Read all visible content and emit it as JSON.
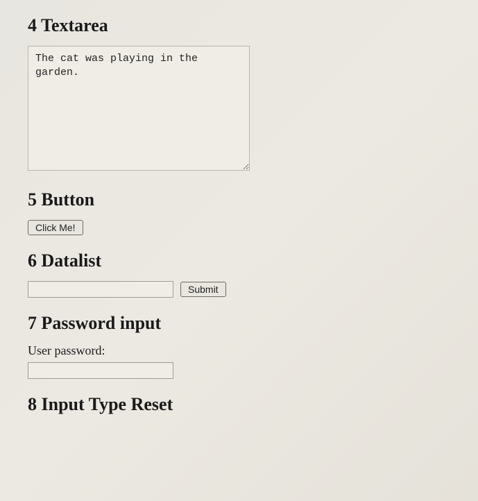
{
  "sections": {
    "textarea": {
      "heading": "4 Textarea",
      "value": "The cat was playing in the garden."
    },
    "button": {
      "heading": "5 Button",
      "label": "Click Me!"
    },
    "datalist": {
      "heading": "6 Datalist",
      "input_value": "",
      "submit_label": "Submit"
    },
    "password": {
      "heading": "7 Password input",
      "label": "User password:",
      "value": ""
    },
    "reset": {
      "heading": "8 Input Type Reset"
    }
  }
}
